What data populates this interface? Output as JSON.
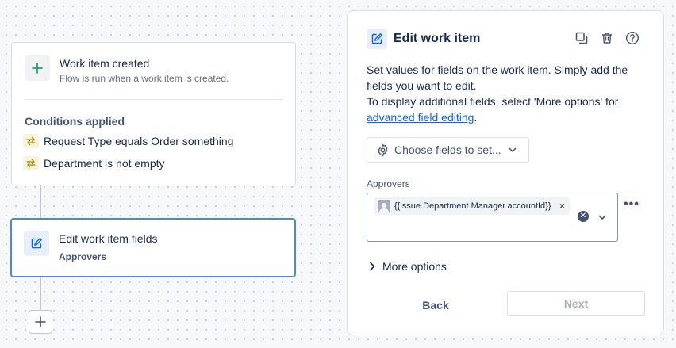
{
  "trigger": {
    "title": "Work item created",
    "subtitle": "Flow is run when a work item is created.",
    "icon": "plus-icon",
    "conditions_heading": "Conditions applied",
    "conditions": [
      {
        "icon": "swap-arrows-icon",
        "text": "Request Type equals Order something"
      },
      {
        "icon": "swap-arrows-icon",
        "text": "Department is not empty"
      }
    ]
  },
  "action": {
    "title": "Edit work item fields",
    "subtitle": "Approvers",
    "icon": "edit-icon"
  },
  "add_step": {
    "icon": "plus-icon"
  },
  "panel": {
    "title": "Edit work item",
    "icon": "edit-icon",
    "header_actions": [
      "duplicate-icon",
      "trash-icon",
      "help-icon"
    ],
    "description_line1": "Set values for fields on the work item. Simply add the fields you want to edit.",
    "description_line2": "To display additional fields, select 'More options' for",
    "advanced_link": "advanced field editing",
    "description_end": ".",
    "choose_fields_label": "Choose fields to set...",
    "field": {
      "label": "Approvers",
      "chip_text": "{{issue.Department.Manager.accountId}}",
      "chip_remove": "×"
    },
    "more_dots": "•••",
    "more_options_label": "More options",
    "back_label": "Back",
    "next_label": "Next"
  },
  "colors": {
    "accent": "#0c66e4",
    "selected_border": "#4c87db",
    "add_green": "#22a06b",
    "condition_icon": "#b38600"
  }
}
